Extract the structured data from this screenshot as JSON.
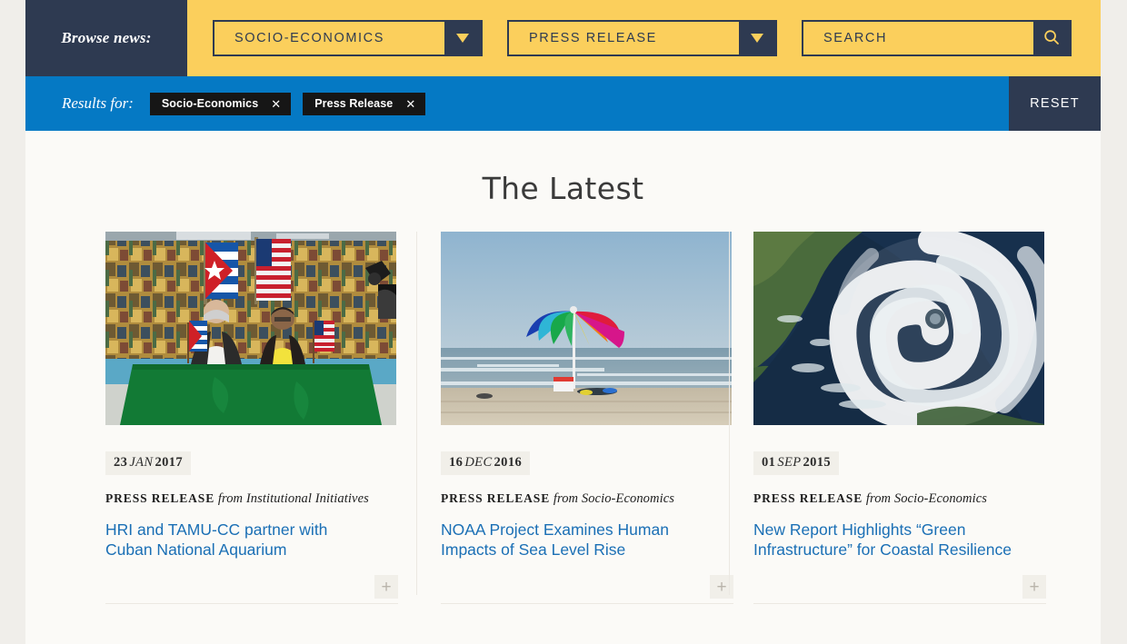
{
  "browse": {
    "label": "Browse news:",
    "category_select": {
      "value": "SOCIO-ECONOMICS"
    },
    "type_select": {
      "value": "PRESS RELEASE"
    },
    "search": {
      "value": "",
      "placeholder": "SEARCH"
    }
  },
  "results": {
    "label": "Results for:",
    "chips": [
      {
        "label": "Socio-Economics",
        "remove": "✕"
      },
      {
        "label": "Press Release",
        "remove": "✕"
      }
    ],
    "reset_label": "RESET"
  },
  "main": {
    "title": "The Latest",
    "expand_label": "+",
    "cards": [
      {
        "image_alt": "cuba-usa-signing-ceremony-photo",
        "date": {
          "day": "23",
          "month": "JAN",
          "year": "2017"
        },
        "type": "PRESS RELEASE",
        "from": "from Institutional Initiatives",
        "headline": "HRI and TAMU-CC partner with Cuban National Aquarium"
      },
      {
        "image_alt": "beach-umbrella-photo",
        "date": {
          "day": "16",
          "month": "DEC",
          "year": "2016"
        },
        "type": "PRESS RELEASE",
        "from": "from Socio-Economics",
        "headline": "NOAA Project Examines Human Impacts of Sea Level Rise"
      },
      {
        "image_alt": "hurricane-satellite-photo",
        "date": {
          "day": "01",
          "month": "SEP",
          "year": "2015"
        },
        "type": "PRESS RELEASE",
        "from": "from Socio-Economics",
        "headline": "New Report Highlights “Green Infrastructure” for Coastal Resilience"
      }
    ]
  },
  "colors": {
    "yellow_bar": "#fbcf5c",
    "navy": "#2e3a51",
    "blue_bar": "#0579c4",
    "link_blue": "#1a6fb5",
    "page_bg": "#fbfaf7",
    "outer_bg": "#f0eeea"
  }
}
